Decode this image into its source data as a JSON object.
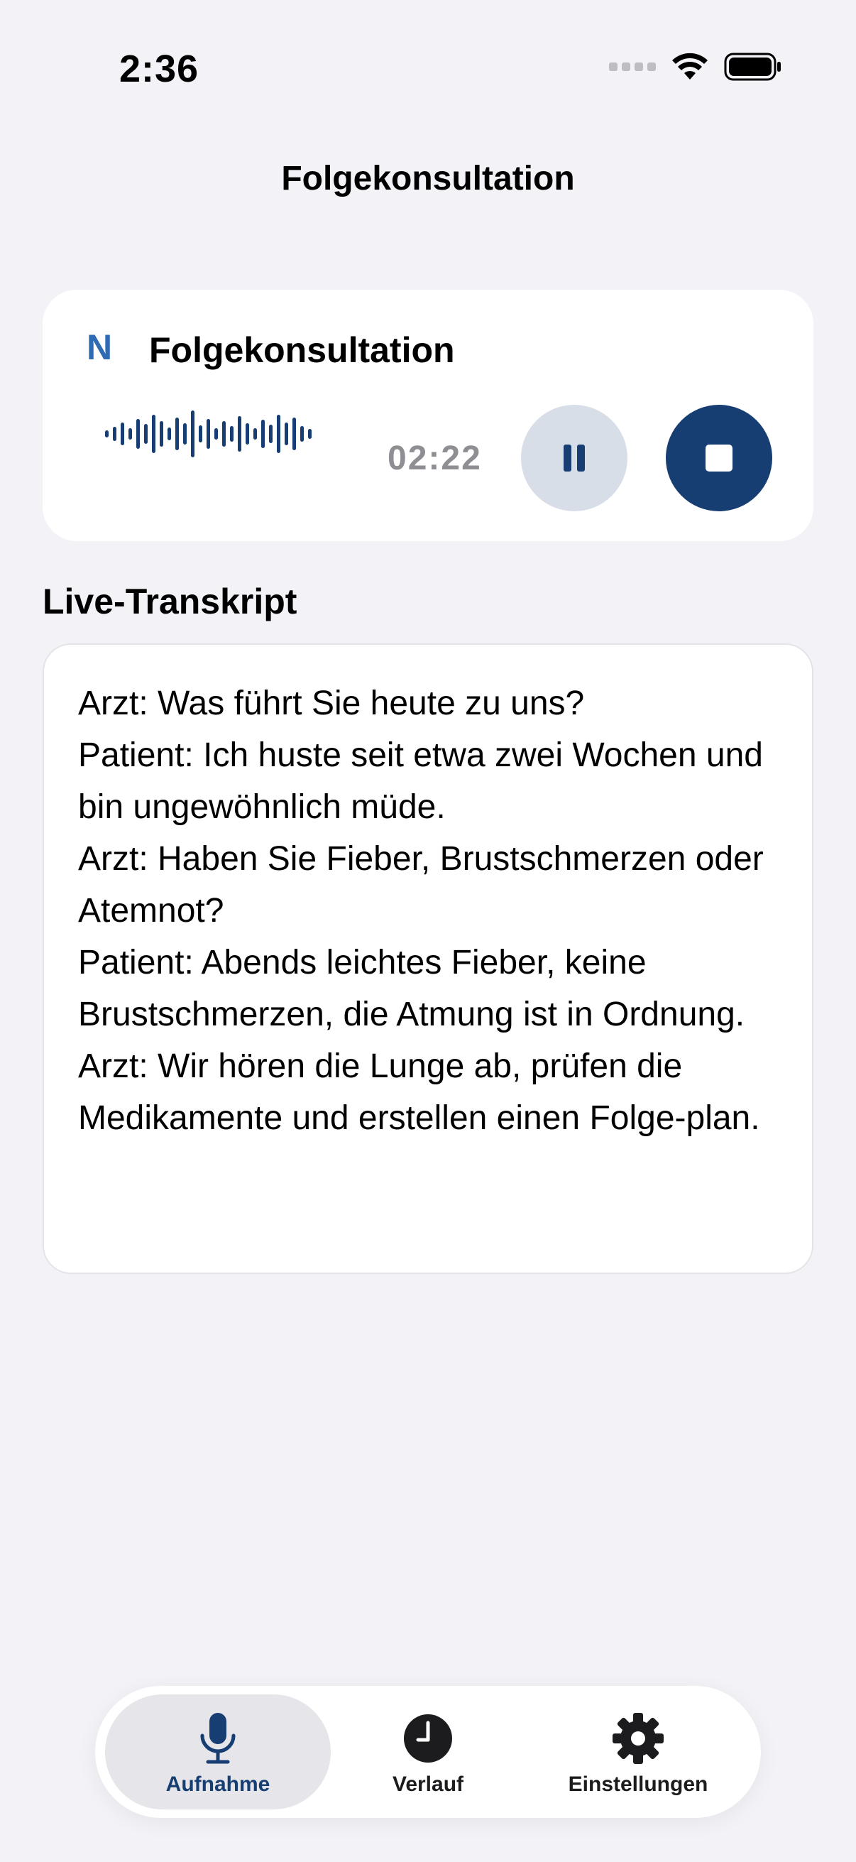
{
  "status_bar": {
    "time": "2:36"
  },
  "header": {
    "title": "Folgekonsultation"
  },
  "recording": {
    "brand_letter": "N",
    "title": "Folgekonsultation",
    "elapsed": "02:22",
    "controls": {
      "pause_icon": "pause-icon",
      "stop_icon": "stop-icon"
    }
  },
  "transcript": {
    "heading": "Live-Transkript",
    "lines": [
      "Arzt: Was führt Sie heute zu uns?",
      "Patient: Ich huste seit etwa zwei Wochen und bin ungewöhnlich müde.",
      "Arzt: Haben Sie Fieber, Brustschmerzen oder Atemnot?",
      "Patient: Abends leichtes Fieber, keine Brustschmerzen, die Atmung ist in Ordnung.",
      "Arzt: Wir hören die Lunge ab, prüfen die Medikamente und erstellen einen Folge-plan."
    ]
  },
  "tab_bar": {
    "tabs": [
      {
        "label": "Aufnahme",
        "icon": "microphone-icon",
        "active": true
      },
      {
        "label": "Verlauf",
        "icon": "clock-icon",
        "active": false
      },
      {
        "label": "Einstellungen",
        "icon": "gear-icon",
        "active": false
      }
    ]
  },
  "colors": {
    "accent": "#173E73",
    "brand": "#2F6BB3",
    "background": "#F2F2F7"
  }
}
